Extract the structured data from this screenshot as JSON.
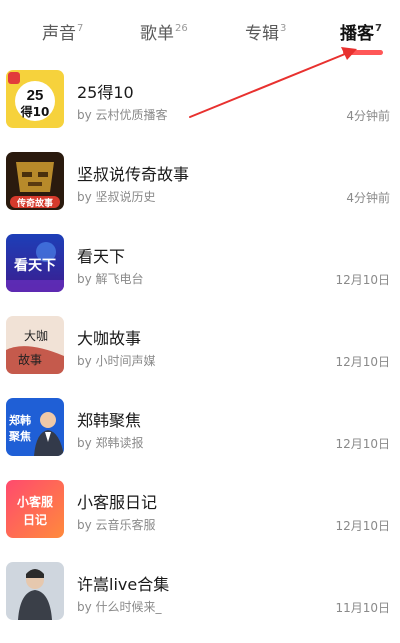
{
  "tabs": [
    {
      "label": "声音",
      "count": "7"
    },
    {
      "label": "歌单",
      "count": "26"
    },
    {
      "label": "专辑",
      "count": "3"
    },
    {
      "label": "播客",
      "count": "7",
      "active": true
    }
  ],
  "podcasts": [
    {
      "title": "25得10",
      "author": "by 云村优质播客",
      "time": "4分钟前",
      "cover_text": "25 得10",
      "cover_icon": "cover-25de10"
    },
    {
      "title": "坚叔说传奇故事",
      "author": "by 坚叔说历史",
      "time": "4分钟前",
      "cover_text": "传奇故事",
      "cover_icon": "cover-bronze-mask"
    },
    {
      "title": "看天下",
      "author": "by 解飞电台",
      "time": "12月10日",
      "cover_text": "看天下",
      "cover_icon": "cover-kantianxia"
    },
    {
      "title": "大咖故事",
      "author": "by 小时间声媒",
      "time": "12月10日",
      "cover_text": "大咖故事",
      "cover_icon": "cover-daka"
    },
    {
      "title": "郑韩聚焦",
      "author": "by 郑韩读报",
      "time": "12月10日",
      "cover_text": "郑韩聚焦",
      "cover_icon": "cover-zhenghan"
    },
    {
      "title": "小客服日记",
      "author": "by 云音乐客服",
      "time": "12月10日",
      "cover_text": "小客服日记",
      "cover_icon": "cover-xiaokefu"
    },
    {
      "title": "许嵩live合集",
      "author": "by 什么时候来_",
      "time": "11月10日",
      "cover_text": "",
      "cover_icon": "cover-xusong"
    }
  ],
  "colors": {
    "accent": "#ff3a3a",
    "arrow": "#e8312f"
  }
}
